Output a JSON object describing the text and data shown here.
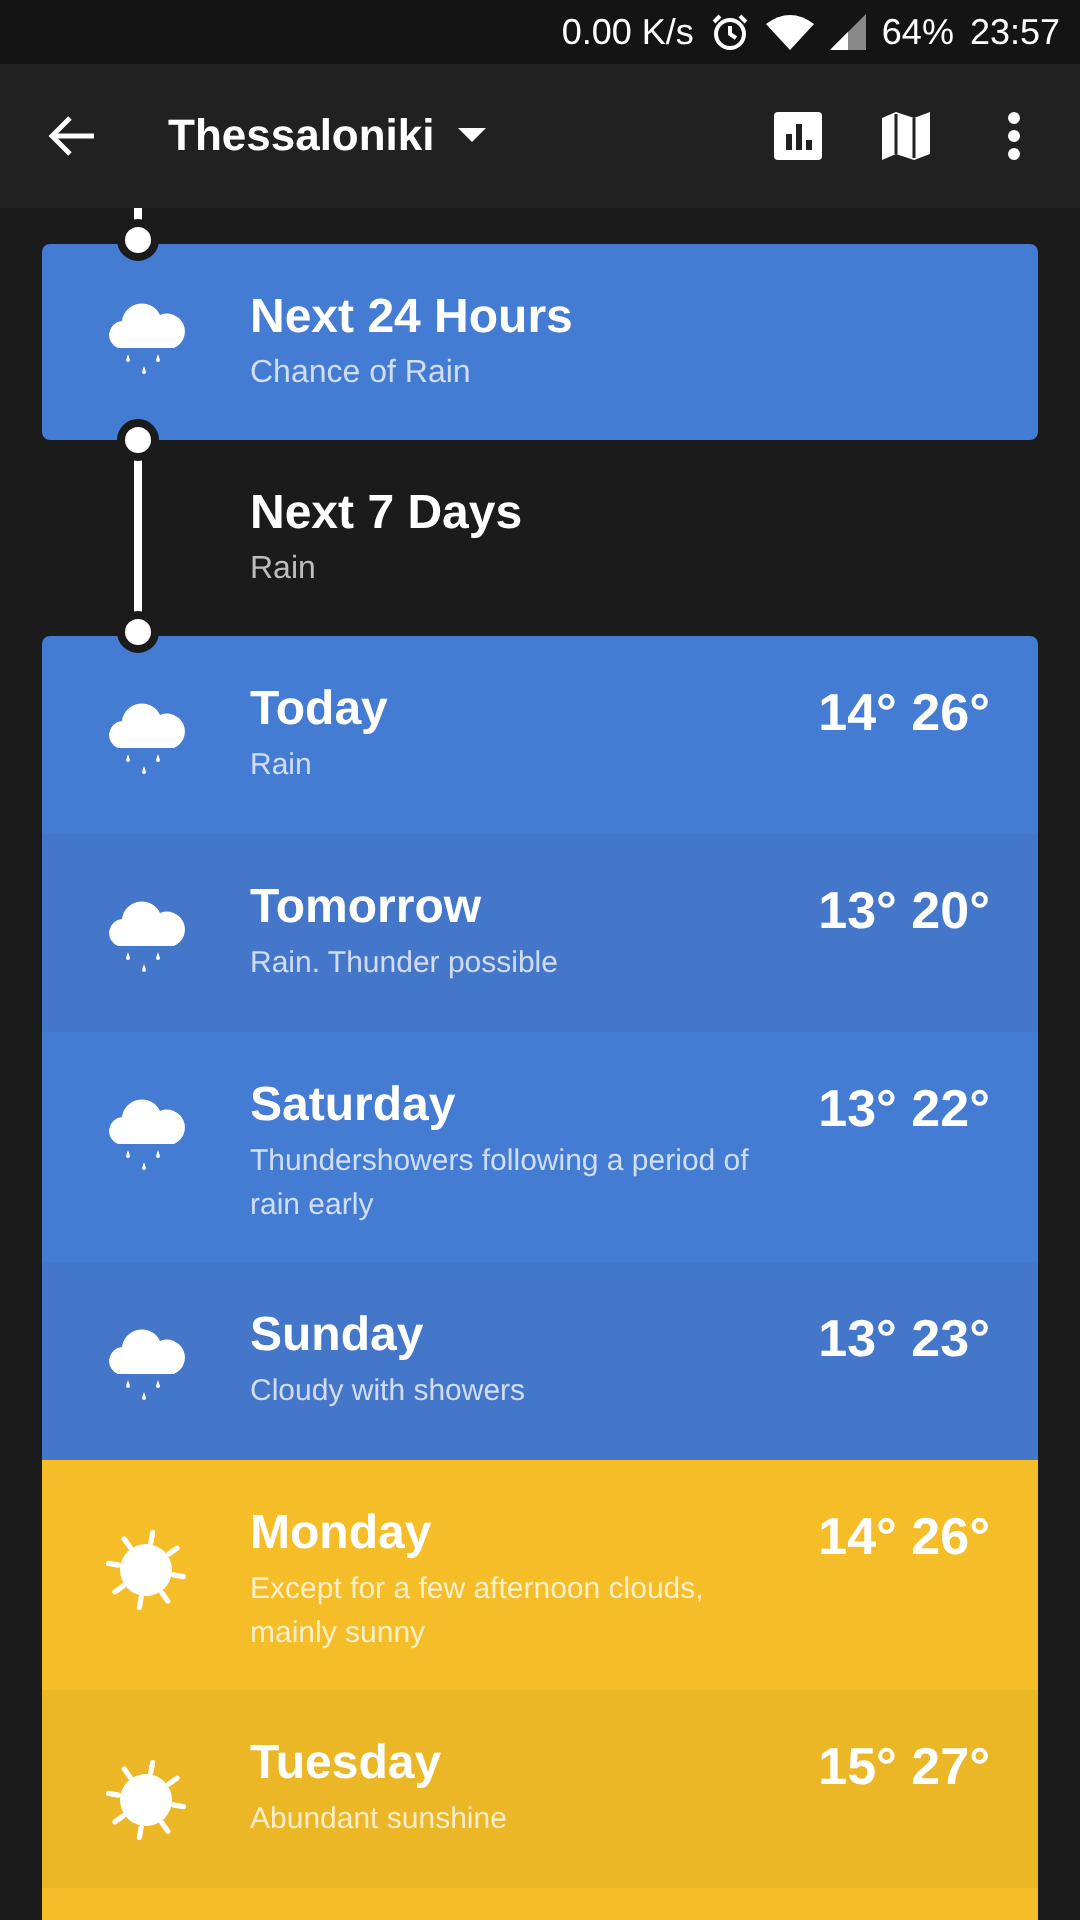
{
  "status_bar": {
    "network_speed": "0.00 K/s",
    "battery": "64%",
    "time": "23:57"
  },
  "app_bar": {
    "title": "Thessaloniki"
  },
  "summary": [
    {
      "title": "Next 24 Hours",
      "subtitle": "Chance of Rain",
      "kind": "rain",
      "selected": true
    },
    {
      "title": "Next 7 Days",
      "subtitle": "Rain",
      "selected": false
    }
  ],
  "days": [
    {
      "name": "Today",
      "description": "Rain",
      "low": "14°",
      "high": "26°",
      "kind": "rain"
    },
    {
      "name": "Tomorrow",
      "description": "Rain. Thunder possible",
      "low": "13°",
      "high": "20°",
      "kind": "rain"
    },
    {
      "name": "Saturday",
      "description": "Thundershowers following a period of rain early",
      "low": "13°",
      "high": "22°",
      "kind": "rain"
    },
    {
      "name": "Sunday",
      "description": "Cloudy with showers",
      "low": "13°",
      "high": "23°",
      "kind": "rain"
    },
    {
      "name": "Monday",
      "description": "Except for a few afternoon clouds, mainly sunny",
      "low": "14°",
      "high": "26°",
      "kind": "sun"
    },
    {
      "name": "Tuesday",
      "description": "Abundant sunshine",
      "low": "15°",
      "high": "27°",
      "kind": "sun"
    }
  ]
}
